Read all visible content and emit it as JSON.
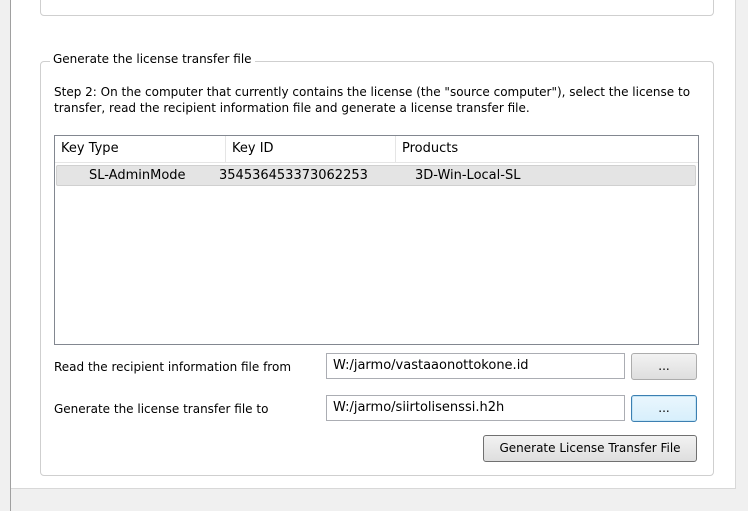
{
  "group": {
    "title": "Generate the license transfer file",
    "instructions": "Step 2: On the computer that currently contains the license (the \"source computer\"), select the license to transfer, read the recipient information file and generate a license transfer file."
  },
  "license_list": {
    "columns": [
      "Key Type",
      "Key ID",
      "Products"
    ],
    "rows": [
      [
        "SL-AdminMode",
        "354536453373062253",
        "3D-Win-Local-SL"
      ]
    ]
  },
  "recipient": {
    "label": "Read the recipient information file from",
    "value": "W:/jarmo/vastaaonottokone.id",
    "browse_label": "..."
  },
  "transfer": {
    "label": "Generate the license transfer file to",
    "value": "W:/jarmo/siirtolisenssi.h2h",
    "browse_label": "..."
  },
  "generate_button": "Generate License Transfer File"
}
